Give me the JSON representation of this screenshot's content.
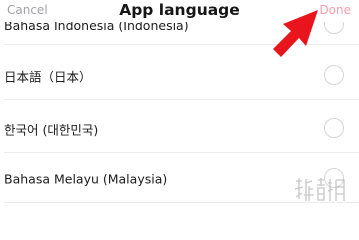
{
  "header": {
    "cancel_label": "Cancel",
    "title": "App language",
    "done_label": "Done"
  },
  "languages": [
    {
      "label": "Bahasa Indonesia (Indonesia)",
      "selected": false
    },
    {
      "label": "日本語（日本）",
      "selected": false
    },
    {
      "label": "한국어 (대한민국)",
      "selected": false
    },
    {
      "label": "Bahasa Melayu (Malaysia)",
      "selected": false
    }
  ],
  "annotation": {
    "arrow_color": "#e8161c",
    "target": "done-button"
  },
  "watermark": {
    "text": "游侠网"
  },
  "colors": {
    "done_accent": "#f4a0ac",
    "cancel_text": "#a2a2a6",
    "title_text": "#161616"
  }
}
